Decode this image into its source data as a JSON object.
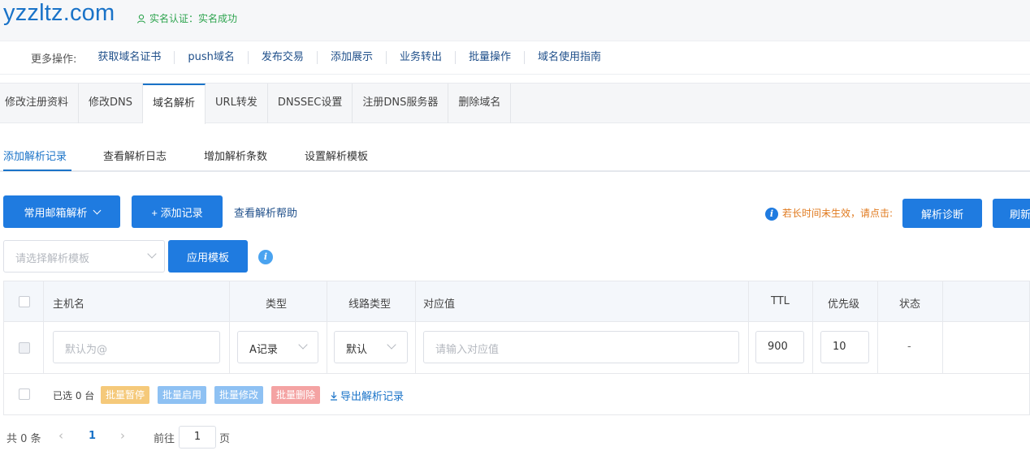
{
  "header": {
    "domain": "yzzltz.com",
    "verify_text": "实名认证：实名成功"
  },
  "more_ops": {
    "label": "更多操作:",
    "items": [
      "获取域名证书",
      "push域名",
      "发布交易",
      "添加展示",
      "业务转出",
      "批量操作",
      "域名使用指南"
    ]
  },
  "main_tabs": [
    "修改注册资料",
    "修改DNS",
    "域名解析",
    "URL转发",
    "DNSSEC设置",
    "注册DNS服务器",
    "删除域名"
  ],
  "sub_tabs": [
    "添加解析记录",
    "查看解析日志",
    "增加解析条数",
    "设置解析模板"
  ],
  "actions": {
    "mail_btn": "常用邮箱解析",
    "add_btn": "+ 添加记录",
    "help_link": "查看解析帮助",
    "warn_text": "若长时间未生效，请点击:",
    "diagnose_btn": "解析诊断",
    "refresh_btn": "刷新"
  },
  "template": {
    "placeholder": "请选择解析模板",
    "apply_btn": "应用模板"
  },
  "table": {
    "headers": [
      "主机名",
      "类型",
      "线路类型",
      "对应值",
      "TTL",
      "优先级",
      "状态"
    ],
    "row": {
      "host_placeholder": "默认为@",
      "type": "A记录",
      "line": "默认",
      "value_placeholder": "请输入对应值",
      "ttl": "900",
      "priority": "10",
      "status": "-"
    },
    "footer": {
      "selected": "已选 0 台",
      "pause": "批量暂停",
      "enable": "批量启用",
      "modify": "批量修改",
      "delete": "批量删除",
      "export": "导出解析记录"
    }
  },
  "pager": {
    "total": "共 0 条",
    "current": "1",
    "goto": "前往",
    "goto_value": "1",
    "page_unit": "页"
  },
  "colors": {
    "primary": "#1f7be0",
    "verify": "#2ea44f",
    "warn": "#e07a1f",
    "tag_pause": "#f5c97a",
    "tag_enable": "#8ec1f3",
    "tag_modify": "#8ec1f3",
    "tag_delete": "#f4a3a3"
  }
}
